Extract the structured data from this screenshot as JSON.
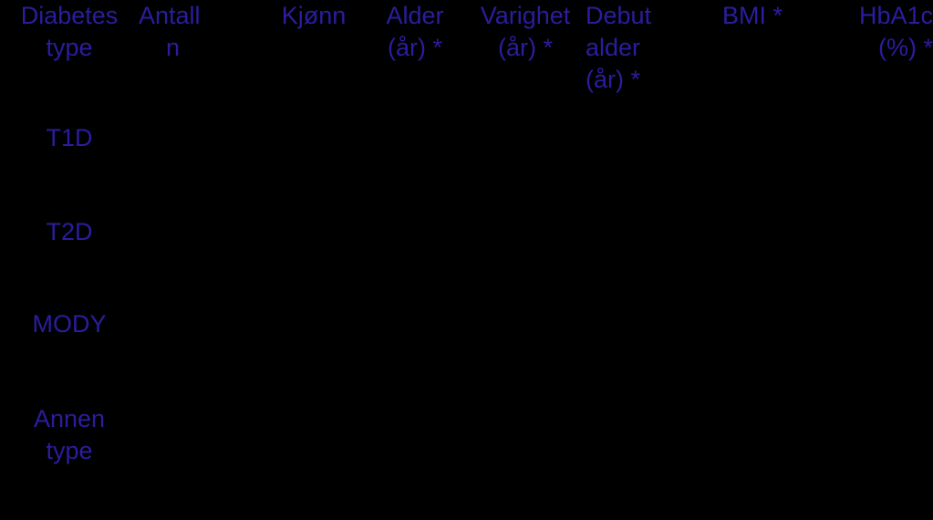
{
  "document": {
    "language": "no",
    "text_color": "#2b1d9e",
    "background_color": "#000000",
    "kind": "table"
  },
  "table": {
    "columns": [
      {
        "key": "diabetes_type",
        "line1": "Diabetes",
        "line2": "type",
        "line3": ""
      },
      {
        "key": "antall",
        "line1": "Antall",
        "line2": "n",
        "line3": ""
      },
      {
        "key": "kjonn",
        "line1": "Kjønn",
        "line2": "",
        "line3": ""
      },
      {
        "key": "alder",
        "line1": "Alder",
        "line2": "(år) *",
        "line3": ""
      },
      {
        "key": "varighet",
        "line1": "Varighet",
        "line2": "(år) *",
        "line3": ""
      },
      {
        "key": "debut_alder",
        "line1": "Debut",
        "line2": "alder",
        "line3": "(år) *"
      },
      {
        "key": "bmi",
        "line1": "BMI *",
        "line2": "",
        "line3": ""
      },
      {
        "key": "hba1c",
        "line1": "HbA1c",
        "line2": "(%) *",
        "line3": ""
      }
    ],
    "rows": [
      {
        "key": "t1d",
        "label_line1": "T1D",
        "label_line2": "",
        "cells": {
          "antall": "",
          "kjonn": "",
          "alder": "",
          "varighet": "",
          "debut_alder": "",
          "bmi": "",
          "hba1c": ""
        }
      },
      {
        "key": "t2d",
        "label_line1": "T2D",
        "label_line2": "",
        "cells": {
          "antall": "",
          "kjonn": "",
          "alder": "",
          "varighet": "",
          "debut_alder": "",
          "bmi": "",
          "hba1c": ""
        }
      },
      {
        "key": "mody",
        "label_line1": "MODY",
        "label_line2": "",
        "cells": {
          "antall": "",
          "kjonn": "",
          "alder": "",
          "varighet": "",
          "debut_alder": "",
          "bmi": "",
          "hba1c": ""
        }
      },
      {
        "key": "annen_type",
        "label_line1": "Annen",
        "label_line2": "type",
        "cells": {
          "antall": "",
          "kjonn": "",
          "alder": "",
          "varighet": "",
          "debut_alder": "",
          "bmi": "",
          "hba1c": ""
        }
      }
    ]
  }
}
